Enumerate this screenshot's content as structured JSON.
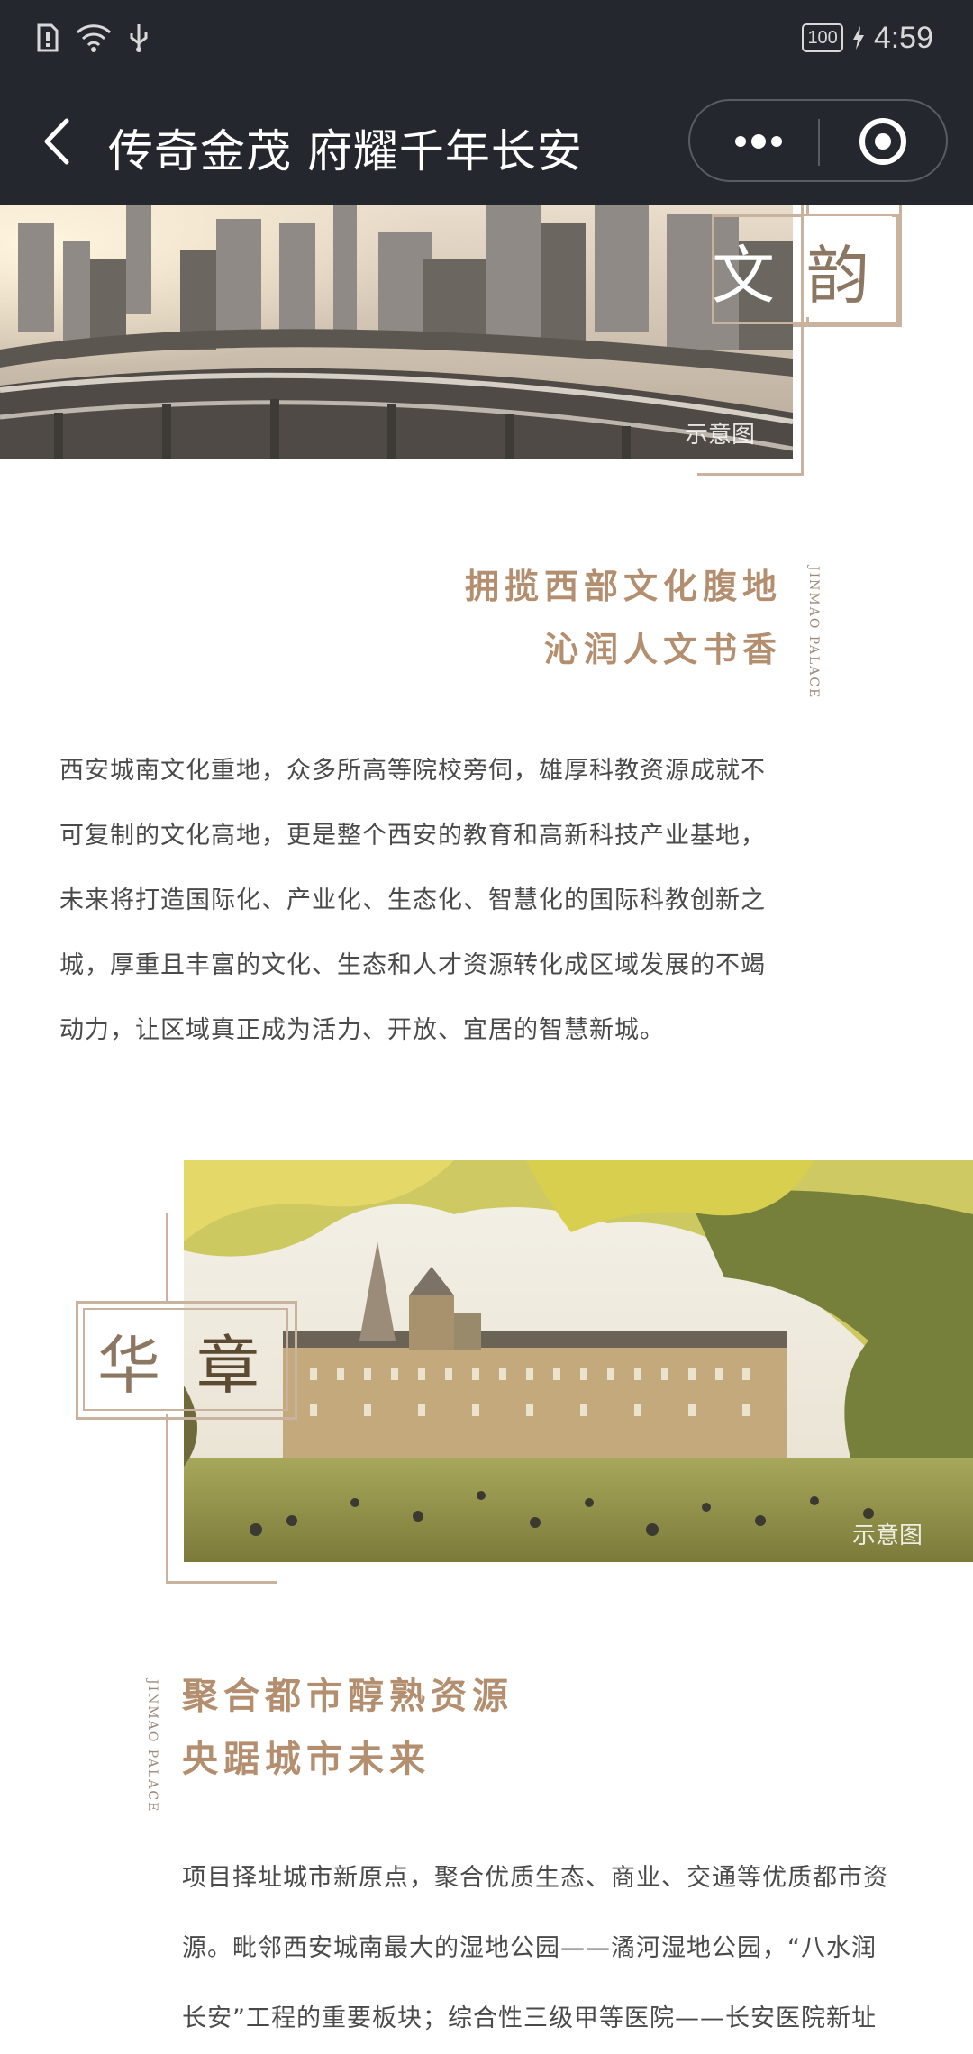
{
  "status_bar": {
    "battery": "100",
    "time": "4:59"
  },
  "nav": {
    "title": "传奇金茂 府耀千年长安"
  },
  "section1": {
    "seal_chars": [
      "文",
      "韵"
    ],
    "watermark": "示意图",
    "title_lines": [
      "拥揽西部文化腹地",
      "沁润人文书香"
    ],
    "brand_tag": "JINMAO PALACE",
    "body_lines": [
      "西安城南文化重地，众多所高等院校旁伺，雄厚科教资源成就不",
      "可复制的文化高地，更是整个西安的教育和高新科技产业基地，",
      "未来将打造国际化、产业化、生态化、智慧化的国际科教创新之",
      "城，厚重且丰富的文化、生态和人才资源转化成区域发展的不竭",
      "动力，让区域真正成为活力、开放、宜居的智慧新城。"
    ]
  },
  "section2": {
    "seal_chars": [
      "华",
      "章"
    ],
    "watermark": "示意图",
    "title_lines": [
      "聚合都市醇熟资源",
      "央踞城市未来"
    ],
    "brand_tag": "JINMAO PALACE",
    "body_lines": [
      "项目择址城市新原点，聚合优质生态、商业、交通等优质都市资",
      "源。毗邻西安城南最大的湿地公园——潏河湿地公园，“八水润",
      "长安”工程的重要板块；综合性三级甲等医院——长安医院新址"
    ]
  },
  "colors": {
    "bar": "#25272f",
    "gold": "#b38f6f",
    "frame": "#c9b29e"
  }
}
